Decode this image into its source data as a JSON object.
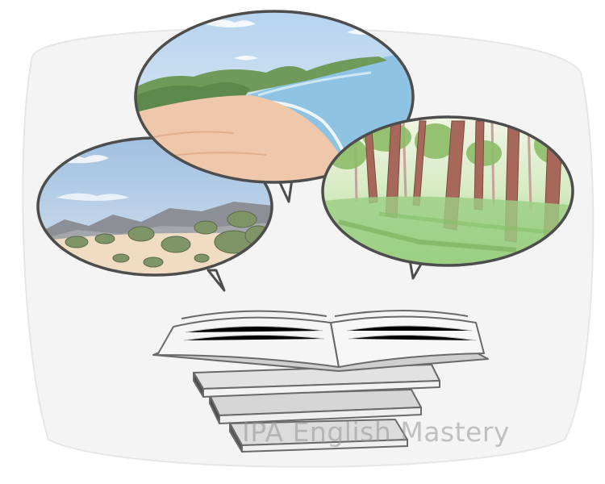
{
  "watermark": {
    "text": "IPA English Mastery"
  },
  "bubbles": [
    {
      "scene": "desert-landscape",
      "sky": "#b9cfe6",
      "ground": "#efdcc3",
      "vegetation": "#7f9467"
    },
    {
      "scene": "sandy-beach",
      "sky": "#c9ddef",
      "ground": "#efc7aa",
      "water": "#8fc3e3",
      "vegetation": "#6f9a5a"
    },
    {
      "scene": "forest",
      "sky": "#e8f1df",
      "ground": "#9ccf85",
      "trunks": "#a5685b",
      "vegetation": "#7fb160"
    }
  ],
  "book_stack": {
    "count": 4,
    "top_book": "open-book"
  },
  "colors": {
    "outline": "#4d4d4d",
    "background_blob": "#f4f4f4"
  }
}
